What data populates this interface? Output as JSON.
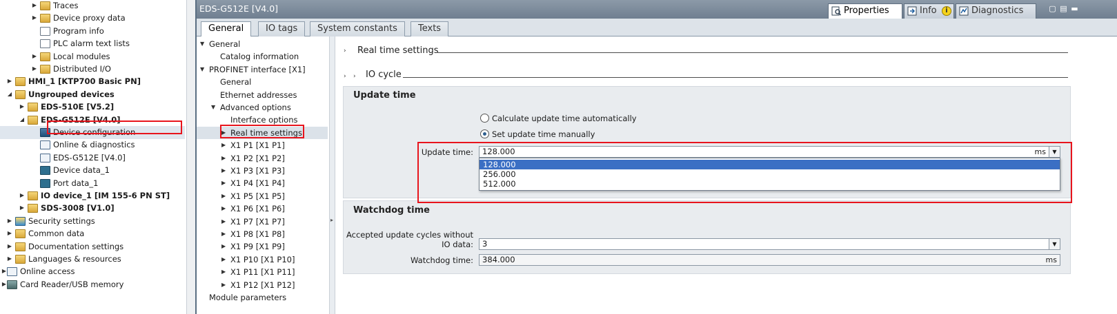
{
  "tree": {
    "items": [
      {
        "label": "Traces",
        "level": 3,
        "arrow": "right",
        "icon": "folder"
      },
      {
        "label": "Device proxy data",
        "level": 3,
        "arrow": "right",
        "icon": "folder"
      },
      {
        "label": "Program info",
        "level": 3,
        "arrow": "",
        "icon": "doc"
      },
      {
        "label": "PLC alarm text lists",
        "level": 3,
        "arrow": "",
        "icon": "doc"
      },
      {
        "label": "Local modules",
        "level": 3,
        "arrow": "right",
        "icon": "folder"
      },
      {
        "label": "Distributed I/O",
        "level": 3,
        "arrow": "right",
        "icon": "folder"
      },
      {
        "label": "HMI_1 [KTP700 Basic PN]",
        "level": 1,
        "arrow": "right",
        "icon": "folder",
        "bold": true
      },
      {
        "label": "Ungrouped devices",
        "level": 1,
        "arrow": "down",
        "icon": "folder",
        "bold": true
      },
      {
        "label": "EDS-510E [V5.2]",
        "level": 2,
        "arrow": "right",
        "icon": "folder",
        "bold": true
      },
      {
        "label": "EDS-G512E [V4.0]",
        "level": 2,
        "arrow": "down",
        "icon": "folder",
        "bold": true
      },
      {
        "label": "Device configuration",
        "level": 3,
        "arrow": "",
        "icon": "dev",
        "highlight": true
      },
      {
        "label": "Online & diagnostics",
        "level": 3,
        "arrow": "",
        "icon": "net"
      },
      {
        "label": "EDS-G512E [V4.0]",
        "level": 3,
        "arrow": "",
        "icon": "net"
      },
      {
        "label": "Device data_1",
        "level": 3,
        "arrow": "",
        "icon": "plc"
      },
      {
        "label": "Port data_1",
        "level": 3,
        "arrow": "",
        "icon": "plc"
      },
      {
        "label": "IO device_1 [IM 155-6 PN ST]",
        "level": 2,
        "arrow": "right",
        "icon": "folder",
        "bold": true
      },
      {
        "label": "SDS-3008 [V1.0]",
        "level": 2,
        "arrow": "right",
        "icon": "folder",
        "bold": true
      },
      {
        "label": "Security settings",
        "level": 1,
        "arrow": "right",
        "icon": "sec"
      },
      {
        "label": "Common data",
        "level": 1,
        "arrow": "right",
        "icon": "folder"
      },
      {
        "label": "Documentation settings",
        "level": 1,
        "arrow": "right",
        "icon": "folder"
      },
      {
        "label": "Languages & resources",
        "level": 1,
        "arrow": "right",
        "icon": "folder"
      },
      {
        "label": "Online access",
        "level": 0,
        "arrow": "right",
        "icon": "net"
      },
      {
        "label": "Card Reader/USB memory",
        "level": 0,
        "arrow": "right",
        "icon": "usb"
      }
    ]
  },
  "inspector": {
    "title": "EDS-G512E [V4.0]",
    "top_tabs": [
      {
        "label": "Properties",
        "active": true
      },
      {
        "label": "Info",
        "active": false
      },
      {
        "label": "Diagnostics",
        "active": false
      }
    ],
    "info_badge": "i",
    "tabs": [
      {
        "label": "General",
        "active": true
      },
      {
        "label": "IO tags",
        "active": false
      },
      {
        "label": "System constants",
        "active": false
      },
      {
        "label": "Texts",
        "active": false
      }
    ]
  },
  "nav": {
    "items": [
      {
        "label": "General",
        "level": 0,
        "arrow": "down"
      },
      {
        "label": "Catalog information",
        "level": 1,
        "arrow": ""
      },
      {
        "label": "PROFINET interface [X1]",
        "level": 0,
        "arrow": "down"
      },
      {
        "label": "General",
        "level": 1,
        "arrow": ""
      },
      {
        "label": "Ethernet addresses",
        "level": 1,
        "arrow": ""
      },
      {
        "label": "Advanced options",
        "level": 1,
        "arrow": "down"
      },
      {
        "label": "Interface options",
        "level": 2,
        "arrow": ""
      },
      {
        "label": "Real time settings",
        "level": 2,
        "arrow": "right",
        "selected": true
      },
      {
        "label": "X1 P1 [X1 P1]",
        "level": 2,
        "arrow": "right"
      },
      {
        "label": "X1 P2 [X1 P2]",
        "level": 2,
        "arrow": "right"
      },
      {
        "label": "X1 P3 [X1 P3]",
        "level": 2,
        "arrow": "right"
      },
      {
        "label": "X1 P4 [X1 P4]",
        "level": 2,
        "arrow": "right"
      },
      {
        "label": "X1 P5 [X1 P5]",
        "level": 2,
        "arrow": "right"
      },
      {
        "label": "X1 P6 [X1 P6]",
        "level": 2,
        "arrow": "right"
      },
      {
        "label": "X1 P7 [X1 P7]",
        "level": 2,
        "arrow": "right"
      },
      {
        "label": "X1 P8 [X1 P8]",
        "level": 2,
        "arrow": "right"
      },
      {
        "label": "X1 P9 [X1 P9]",
        "level": 2,
        "arrow": "right"
      },
      {
        "label": "X1 P10 [X1 P10]",
        "level": 2,
        "arrow": "right"
      },
      {
        "label": "X1 P11 [X1 P11]",
        "level": 2,
        "arrow": "right"
      },
      {
        "label": "X1 P12 [X1 P12]",
        "level": 2,
        "arrow": "right"
      },
      {
        "label": "Module parameters",
        "level": 0,
        "arrow": ""
      }
    ]
  },
  "content": {
    "section_realtime": "Real time settings",
    "section_iocycle": "IO cycle",
    "update_panel_title": "Update time",
    "radio_auto": "Calculate update time automatically",
    "radio_manual": "Set update time manually",
    "update_label": "Update time:",
    "update_value": "128.000",
    "update_unit": "ms",
    "dropdown_options": [
      "128.000",
      "256.000",
      "512.000"
    ],
    "watchdog_panel_title": "Watchdog time",
    "accepted_label_1": "Accepted update cycles without",
    "accepted_label_2": "IO data:",
    "accepted_value": "3",
    "watchdog_label": "Watchdog time:",
    "watchdog_value": "384.000",
    "watchdog_unit": "ms"
  },
  "colors": {
    "highlight_box": "#e8141c",
    "selection": "#3b6fc4"
  }
}
